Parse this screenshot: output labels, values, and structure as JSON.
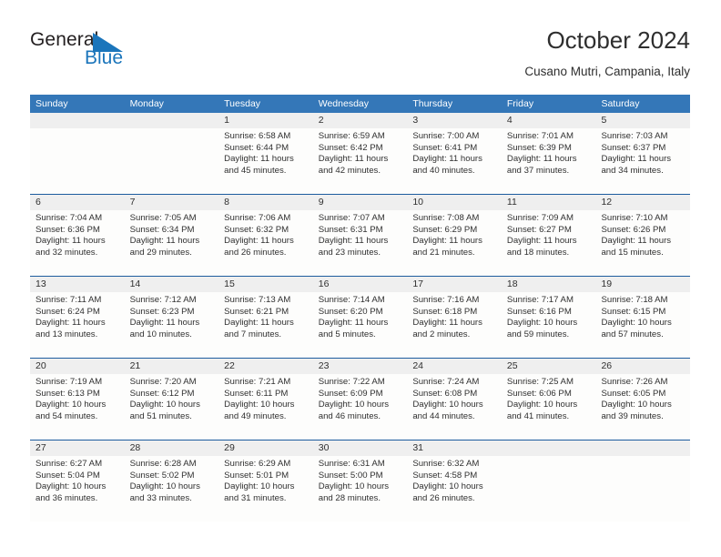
{
  "brand": {
    "name_top": "General",
    "name_bottom": "Blue",
    "flag_color": "#1b75bb",
    "text_color": "#231f20"
  },
  "header": {
    "title": "October 2024",
    "subtitle": "Cusano Mutri, Campania, Italy"
  },
  "theme": {
    "header_bar": "#3477b8",
    "row_divider": "#1d5c9e",
    "daynum_band": "#efefef",
    "cell_bg": "#fdfdfc",
    "text": "#303030"
  },
  "weekdays": [
    "Sunday",
    "Monday",
    "Tuesday",
    "Wednesday",
    "Thursday",
    "Friday",
    "Saturday"
  ],
  "labels": {
    "sunrise": "Sunrise:",
    "sunset": "Sunset:",
    "daylight": "Daylight:"
  },
  "weeks": [
    [
      {
        "day": "",
        "sunrise": "",
        "sunset": "",
        "daylight": ""
      },
      {
        "day": "",
        "sunrise": "",
        "sunset": "",
        "daylight": ""
      },
      {
        "day": "1",
        "sunrise": "Sunrise: 6:58 AM",
        "sunset": "Sunset: 6:44 PM",
        "daylight": "Daylight: 11 hours and 45 minutes."
      },
      {
        "day": "2",
        "sunrise": "Sunrise: 6:59 AM",
        "sunset": "Sunset: 6:42 PM",
        "daylight": "Daylight: 11 hours and 42 minutes."
      },
      {
        "day": "3",
        "sunrise": "Sunrise: 7:00 AM",
        "sunset": "Sunset: 6:41 PM",
        "daylight": "Daylight: 11 hours and 40 minutes."
      },
      {
        "day": "4",
        "sunrise": "Sunrise: 7:01 AM",
        "sunset": "Sunset: 6:39 PM",
        "daylight": "Daylight: 11 hours and 37 minutes."
      },
      {
        "day": "5",
        "sunrise": "Sunrise: 7:03 AM",
        "sunset": "Sunset: 6:37 PM",
        "daylight": "Daylight: 11 hours and 34 minutes."
      }
    ],
    [
      {
        "day": "6",
        "sunrise": "Sunrise: 7:04 AM",
        "sunset": "Sunset: 6:36 PM",
        "daylight": "Daylight: 11 hours and 32 minutes."
      },
      {
        "day": "7",
        "sunrise": "Sunrise: 7:05 AM",
        "sunset": "Sunset: 6:34 PM",
        "daylight": "Daylight: 11 hours and 29 minutes."
      },
      {
        "day": "8",
        "sunrise": "Sunrise: 7:06 AM",
        "sunset": "Sunset: 6:32 PM",
        "daylight": "Daylight: 11 hours and 26 minutes."
      },
      {
        "day": "9",
        "sunrise": "Sunrise: 7:07 AM",
        "sunset": "Sunset: 6:31 PM",
        "daylight": "Daylight: 11 hours and 23 minutes."
      },
      {
        "day": "10",
        "sunrise": "Sunrise: 7:08 AM",
        "sunset": "Sunset: 6:29 PM",
        "daylight": "Daylight: 11 hours and 21 minutes."
      },
      {
        "day": "11",
        "sunrise": "Sunrise: 7:09 AM",
        "sunset": "Sunset: 6:27 PM",
        "daylight": "Daylight: 11 hours and 18 minutes."
      },
      {
        "day": "12",
        "sunrise": "Sunrise: 7:10 AM",
        "sunset": "Sunset: 6:26 PM",
        "daylight": "Daylight: 11 hours and 15 minutes."
      }
    ],
    [
      {
        "day": "13",
        "sunrise": "Sunrise: 7:11 AM",
        "sunset": "Sunset: 6:24 PM",
        "daylight": "Daylight: 11 hours and 13 minutes."
      },
      {
        "day": "14",
        "sunrise": "Sunrise: 7:12 AM",
        "sunset": "Sunset: 6:23 PM",
        "daylight": "Daylight: 11 hours and 10 minutes."
      },
      {
        "day": "15",
        "sunrise": "Sunrise: 7:13 AM",
        "sunset": "Sunset: 6:21 PM",
        "daylight": "Daylight: 11 hours and 7 minutes."
      },
      {
        "day": "16",
        "sunrise": "Sunrise: 7:14 AM",
        "sunset": "Sunset: 6:20 PM",
        "daylight": "Daylight: 11 hours and 5 minutes."
      },
      {
        "day": "17",
        "sunrise": "Sunrise: 7:16 AM",
        "sunset": "Sunset: 6:18 PM",
        "daylight": "Daylight: 11 hours and 2 minutes."
      },
      {
        "day": "18",
        "sunrise": "Sunrise: 7:17 AM",
        "sunset": "Sunset: 6:16 PM",
        "daylight": "Daylight: 10 hours and 59 minutes."
      },
      {
        "day": "19",
        "sunrise": "Sunrise: 7:18 AM",
        "sunset": "Sunset: 6:15 PM",
        "daylight": "Daylight: 10 hours and 57 minutes."
      }
    ],
    [
      {
        "day": "20",
        "sunrise": "Sunrise: 7:19 AM",
        "sunset": "Sunset: 6:13 PM",
        "daylight": "Daylight: 10 hours and 54 minutes."
      },
      {
        "day": "21",
        "sunrise": "Sunrise: 7:20 AM",
        "sunset": "Sunset: 6:12 PM",
        "daylight": "Daylight: 10 hours and 51 minutes."
      },
      {
        "day": "22",
        "sunrise": "Sunrise: 7:21 AM",
        "sunset": "Sunset: 6:11 PM",
        "daylight": "Daylight: 10 hours and 49 minutes."
      },
      {
        "day": "23",
        "sunrise": "Sunrise: 7:22 AM",
        "sunset": "Sunset: 6:09 PM",
        "daylight": "Daylight: 10 hours and 46 minutes."
      },
      {
        "day": "24",
        "sunrise": "Sunrise: 7:24 AM",
        "sunset": "Sunset: 6:08 PM",
        "daylight": "Daylight: 10 hours and 44 minutes."
      },
      {
        "day": "25",
        "sunrise": "Sunrise: 7:25 AM",
        "sunset": "Sunset: 6:06 PM",
        "daylight": "Daylight: 10 hours and 41 minutes."
      },
      {
        "day": "26",
        "sunrise": "Sunrise: 7:26 AM",
        "sunset": "Sunset: 6:05 PM",
        "daylight": "Daylight: 10 hours and 39 minutes."
      }
    ],
    [
      {
        "day": "27",
        "sunrise": "Sunrise: 6:27 AM",
        "sunset": "Sunset: 5:04 PM",
        "daylight": "Daylight: 10 hours and 36 minutes."
      },
      {
        "day": "28",
        "sunrise": "Sunrise: 6:28 AM",
        "sunset": "Sunset: 5:02 PM",
        "daylight": "Daylight: 10 hours and 33 minutes."
      },
      {
        "day": "29",
        "sunrise": "Sunrise: 6:29 AM",
        "sunset": "Sunset: 5:01 PM",
        "daylight": "Daylight: 10 hours and 31 minutes."
      },
      {
        "day": "30",
        "sunrise": "Sunrise: 6:31 AM",
        "sunset": "Sunset: 5:00 PM",
        "daylight": "Daylight: 10 hours and 28 minutes."
      },
      {
        "day": "31",
        "sunrise": "Sunrise: 6:32 AM",
        "sunset": "Sunset: 4:58 PM",
        "daylight": "Daylight: 10 hours and 26 minutes."
      },
      {
        "day": "",
        "sunrise": "",
        "sunset": "",
        "daylight": ""
      },
      {
        "day": "",
        "sunrise": "",
        "sunset": "",
        "daylight": ""
      }
    ]
  ]
}
